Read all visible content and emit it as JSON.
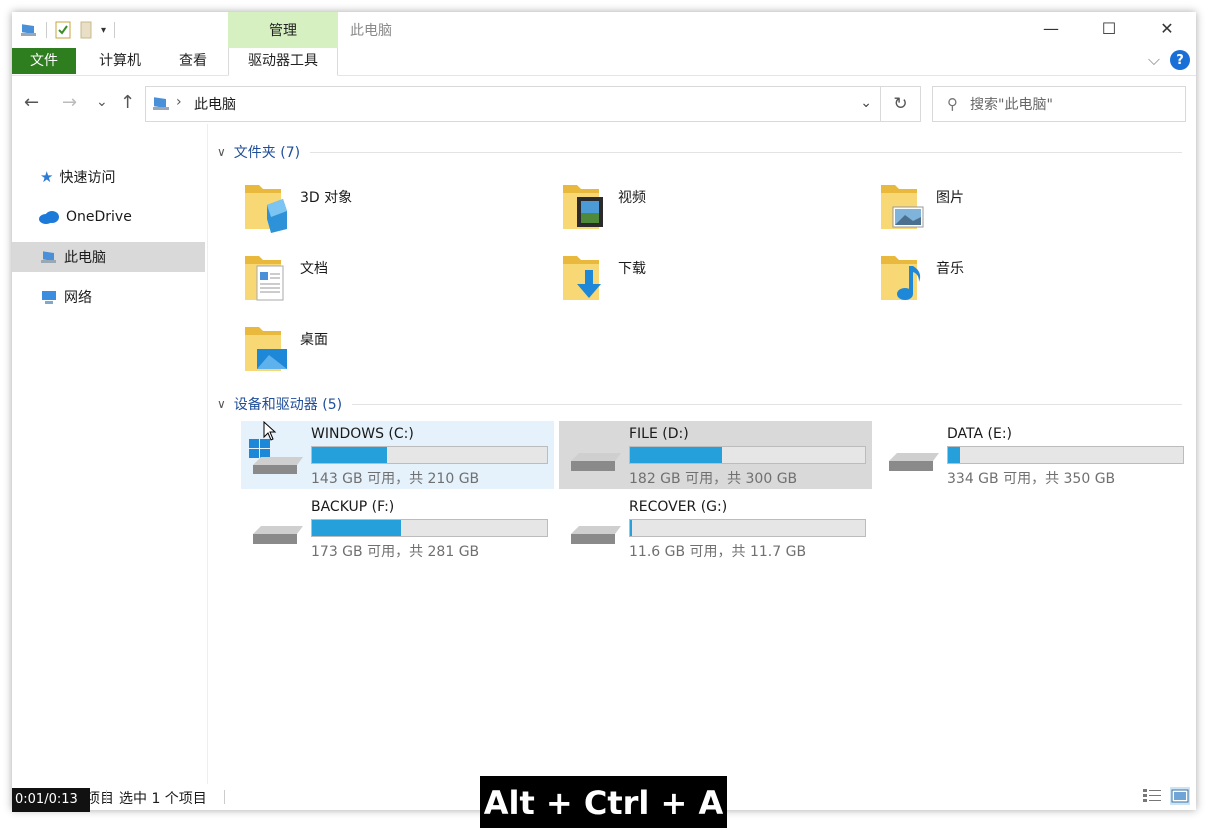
{
  "titlebar": {
    "manage_tab": "管理",
    "title": "此电脑",
    "minimize": "—",
    "maximize": "☐",
    "close": "✕"
  },
  "ribbon": {
    "file": "文件",
    "computer": "计算机",
    "view": "查看",
    "drive_tools": "驱动器工具",
    "collapse": "⌵",
    "help": "?"
  },
  "nav": {
    "back": "←",
    "forward": "→",
    "recent": "⌄",
    "up": "↑",
    "path_sep": "›",
    "path": "此电脑",
    "dropdown": "⌄",
    "refresh": "↻",
    "search_placeholder": "搜索\"此电脑\""
  },
  "sidebar": {
    "items": [
      {
        "label": "快速访问",
        "icon": "star-icon"
      },
      {
        "label": "OneDrive",
        "icon": "cloud-icon"
      },
      {
        "label": "此电脑",
        "icon": "computer-icon"
      },
      {
        "label": "网络",
        "icon": "network-icon"
      }
    ]
  },
  "folders_group": {
    "header": "文件夹 (7)",
    "items": [
      {
        "label": "3D 对象",
        "icon": "3d-objects-folder-icon"
      },
      {
        "label": "视频",
        "icon": "videos-folder-icon"
      },
      {
        "label": "图片",
        "icon": "pictures-folder-icon"
      },
      {
        "label": "文档",
        "icon": "documents-folder-icon"
      },
      {
        "label": "下载",
        "icon": "downloads-folder-icon"
      },
      {
        "label": "音乐",
        "icon": "music-folder-icon"
      },
      {
        "label": "桌面",
        "icon": "desktop-folder-icon"
      }
    ]
  },
  "drives_group": {
    "header": "设备和驱动器 (5)",
    "items": [
      {
        "name": "WINDOWS (C:)",
        "free": "143 GB 可用，共 210 GB",
        "used_fraction": 0.32
      },
      {
        "name": "FILE (D:)",
        "free": "182 GB 可用，共 300 GB",
        "used_fraction": 0.39
      },
      {
        "name": "DATA (E:)",
        "free": "334 GB 可用，共 350 GB",
        "used_fraction": 0.05
      },
      {
        "name": "BACKUP (F:)",
        "free": "173 GB 可用，共 281 GB",
        "used_fraction": 0.38
      },
      {
        "name": "RECOVER (G:)",
        "free": "11.6 GB 可用，共 11.7 GB",
        "used_fraction": 0.01
      }
    ]
  },
  "status": {
    "items_count": "项目",
    "selected": "选中 1 个项目"
  },
  "overlay": {
    "timer": "0:01/0:13",
    "keys": "Alt + Ctrl + A"
  },
  "colors": {
    "accent": "#26a0da",
    "file_tab": "#2e7d1f",
    "manage_tab": "#d6f0c2",
    "header_text": "#1f4e99"
  }
}
